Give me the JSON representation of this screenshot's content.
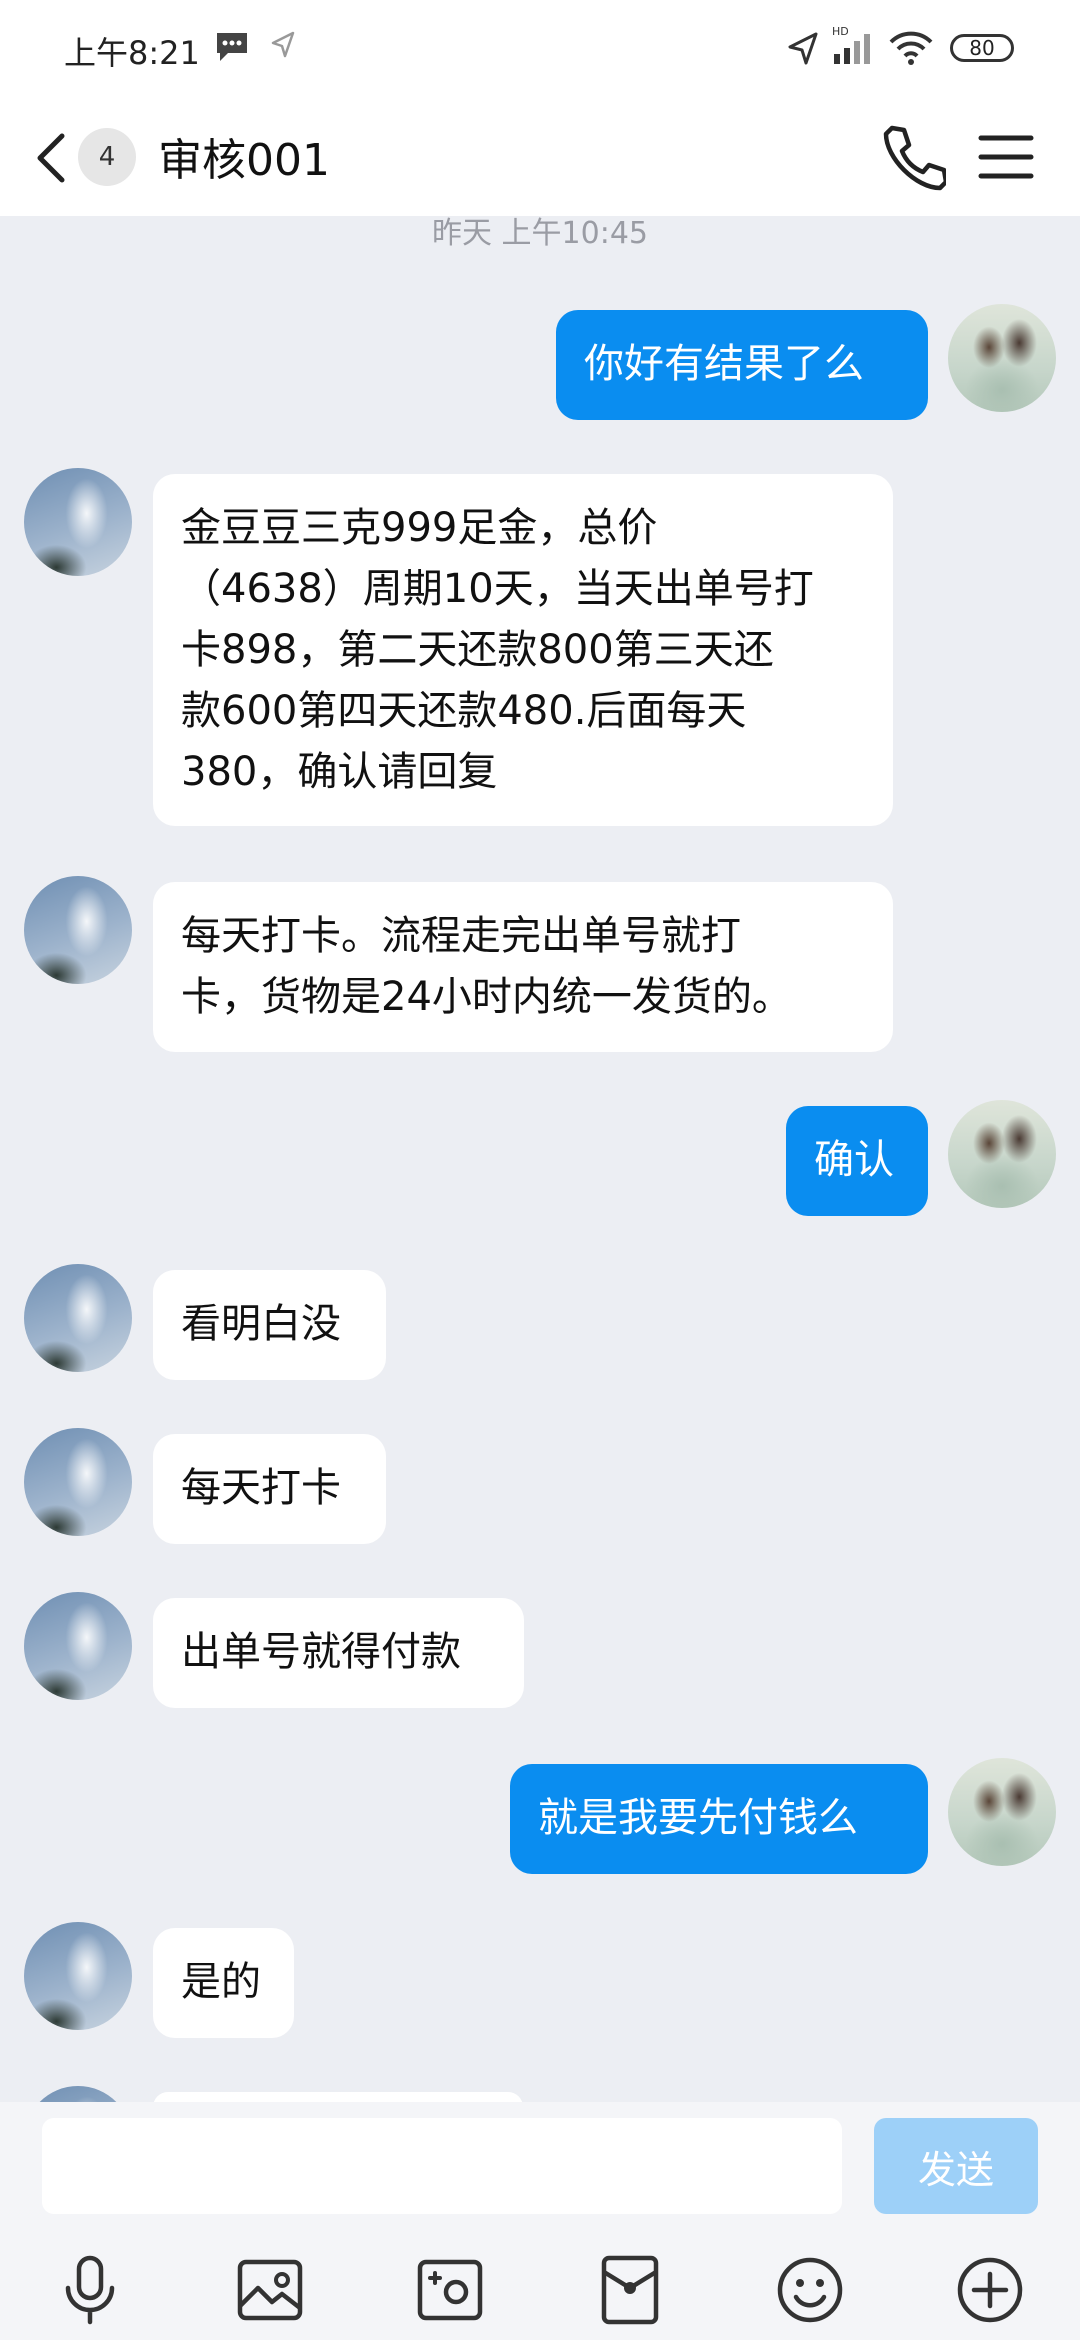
{
  "status_bar": {
    "time": "上午8:21",
    "network": "HD",
    "battery": "80"
  },
  "header": {
    "unread_count": "4",
    "title": "审核001"
  },
  "timestamp": "昨天 上午10:45",
  "messages": [
    {
      "from": "self",
      "text": "你好有结果了么"
    },
    {
      "from": "peer",
      "text": "金豆豆三克999足金，总价\n（4638）周期10天，当天出单号打\n卡898，第二天还款800第三天还\n款600第四天还款480.后面每天\n380，确认请回复"
    },
    {
      "from": "peer",
      "text": "每天打卡。流程走完出单号就打\n卡，货物是24小时内统一发货的。"
    },
    {
      "from": "self",
      "text": "确认"
    },
    {
      "from": "peer",
      "text": "看明白没"
    },
    {
      "from": "peer",
      "text": "每天打卡"
    },
    {
      "from": "peer",
      "text": "出单号就得付款"
    },
    {
      "from": "self",
      "text": "就是我要先付钱么"
    },
    {
      "from": "peer",
      "text": "是的"
    }
  ],
  "input": {
    "value": "",
    "placeholder": "",
    "send_label": "发送"
  },
  "toolbar": {
    "icons": [
      "microphone-icon",
      "image-icon",
      "camera-icon",
      "red-packet-icon",
      "emoji-icon",
      "plus-icon"
    ]
  },
  "colors": {
    "outgoing_bubble": "#0a8df0",
    "incoming_bubble": "#ffffff",
    "chat_background": "#eceef3",
    "send_button": "#9dd0f8"
  }
}
